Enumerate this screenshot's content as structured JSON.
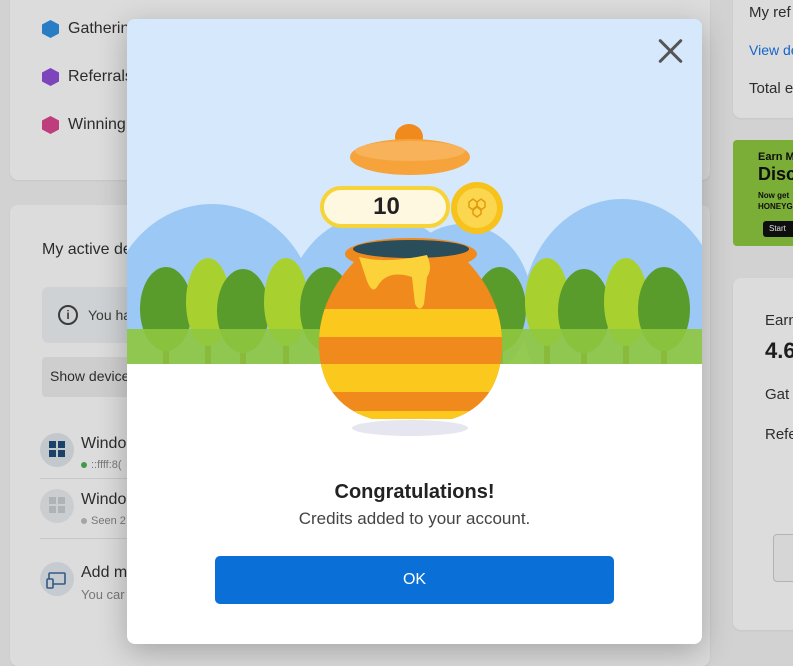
{
  "background": {
    "sources": [
      {
        "label": "Gatherin",
        "color": "#2f8fe0"
      },
      {
        "label": "Referrals",
        "color": "#8e4fd6"
      },
      {
        "label": "Winning",
        "color": "#d9478f"
      }
    ],
    "devices_title": "My active de",
    "info_text": "You ha",
    "show_devices_label": "Show device",
    "devices": [
      {
        "name": "Windo",
        "sub": "::ffff:8(",
        "status_color": "#4caf50"
      },
      {
        "name": "Windo",
        "sub": "Seen 2",
        "status_color": "#bbbbbb"
      }
    ],
    "add_device": {
      "title": "Add mo",
      "sub": "You car"
    },
    "referral": {
      "title": "My ref",
      "link": "View de",
      "total": "Total e"
    },
    "promo": {
      "line1": "Earn M",
      "line2": "Disc",
      "line3a": "Now get",
      "line3b": "HONEYG",
      "button": "Start"
    },
    "earn": {
      "title": "Earn",
      "big": "4.6",
      "row1": "Gat",
      "row2": "Refe"
    }
  },
  "modal": {
    "credit_amount": "10",
    "title": "Congratulations!",
    "subtitle": "Credits added to your account.",
    "ok_label": "OK",
    "colors": {
      "sky": "#d6e8fb",
      "hills": "#9cc8f5",
      "grass": "#8ec63f",
      "pot_orange": "#f08a1c",
      "pot_yellow": "#fbc81e",
      "coin": "#f7c21c",
      "button": "#0a6fd6"
    }
  }
}
